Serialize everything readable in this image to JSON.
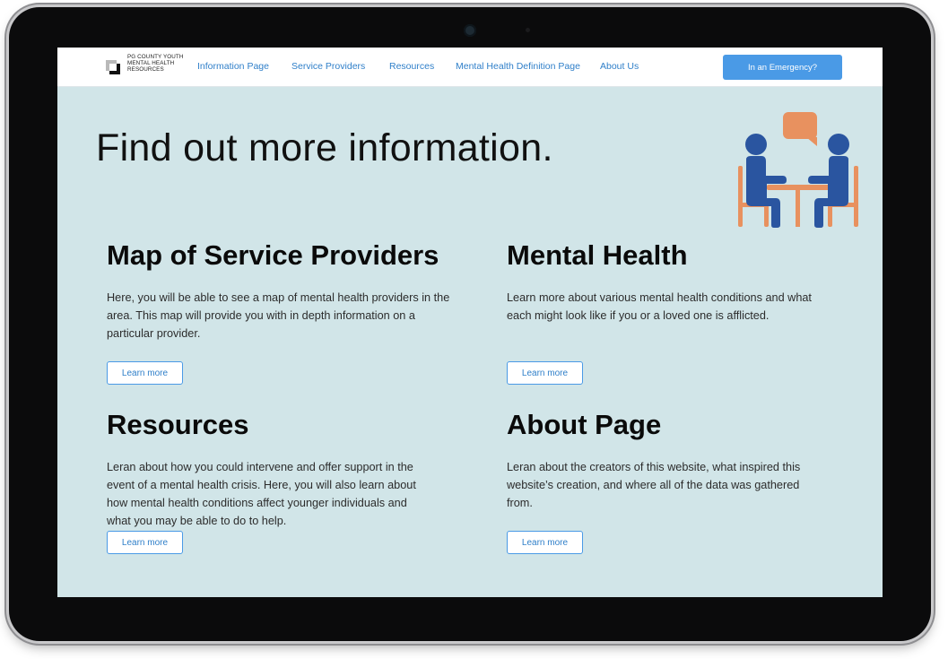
{
  "header": {
    "logo_text": "PG COUNTY YOUTH MENTAL HEALTH RESOURCES",
    "nav_links": [
      "Information Page",
      "Service Providers",
      "Resources",
      "Mental Health Definition Page",
      "About Us"
    ],
    "emergency_label": "In an Emergency?"
  },
  "hero": {
    "title": "Find out more information."
  },
  "sections": [
    {
      "title": "Map of Service Providers",
      "body": "Here, you will be able to see a map of mental health providers in the area. This map will provide you with in depth information on a particular provider.",
      "button": "Learn more"
    },
    {
      "title": "Mental Health",
      "body": "Learn more about various mental health conditions and what each might look like if you or a loved one is afflicted.",
      "button": "Learn more"
    },
    {
      "title": "Resources",
      "body": "Leran about how you could intervene and offer support in the event of a mental health crisis. Here, you will also learn about how mental health conditions affect younger individuals and what you may be able to do to help.",
      "button": "Learn more"
    },
    {
      "title": "About Page",
      "body": "Leran about the creators of this website, what inspired this website’s creation, and where all of the data was gathered from.",
      "button": "Learn more"
    }
  ],
  "colors": {
    "accent": "#4a9ae6",
    "page_bg": "#d1e5e8",
    "illustration_people": "#2a55a0",
    "illustration_furniture": "#e8915f"
  },
  "icons": [
    "logo-mark-icon",
    "conversation-illustration"
  ]
}
